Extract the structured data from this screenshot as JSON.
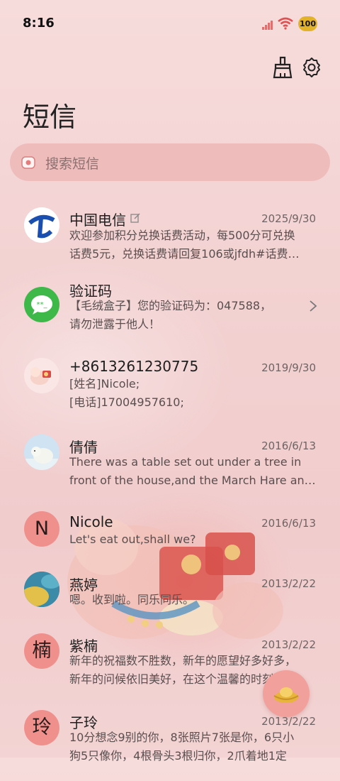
{
  "status_bar": {
    "time": "8:16",
    "battery": "100"
  },
  "header": {
    "title": "短信"
  },
  "search": {
    "placeholder": "搜索短信"
  },
  "conversations": [
    {
      "name": "中国电信",
      "date": "2025/9/30",
      "preview": [
        "欢迎参加积分兑换话费活动，每500分可兑换",
        "话费5元，兑换话费请回复106或jfdh#话费…"
      ]
    },
    {
      "name": "验证码",
      "date": "",
      "preview": [
        "【毛绒盒子】您的验证码为：047588，",
        "请勿泄露于他人！"
      ]
    },
    {
      "name": "+8613261230775",
      "date": "2019/9/30",
      "preview": [
        "[姓名]Nicole;",
        "[电话]17004957610;"
      ]
    },
    {
      "name": "倩倩",
      "date": "2016/6/13",
      "preview": [
        "There was a table set out under a tree in",
        "front of the house,and the March Hare an…"
      ]
    },
    {
      "name": "Nicole",
      "date": "2016/6/13",
      "avatar_letter": "N",
      "preview": [
        "Let's eat out,shall we?"
      ]
    },
    {
      "name": "燕婷",
      "date": "2013/2/22",
      "preview": [
        "嗯。收到啦。同乐同乐。"
      ]
    },
    {
      "name": "紫楠",
      "date": "2013/2/22",
      "avatar_letter": "楠",
      "preview": [
        "新年的祝福数不胜数，新年的愿望好多好多，",
        "新年的问候依旧美好，在这个温馨的时刻，…"
      ]
    },
    {
      "name": "子玲",
      "date": "2013/2/22",
      "avatar_letter": "玲",
      "preview": [
        "10分想念9别的你，8张照片7张是你，6只小",
        "狗5只像你，4根骨头3根归你，2爪着地1定"
      ]
    }
  ],
  "colors": {
    "accent": "#f0908c",
    "search_bg": "#efbcbc",
    "verification_green": "#3fb84a",
    "telecom_blue": "#1a4fb0"
  }
}
